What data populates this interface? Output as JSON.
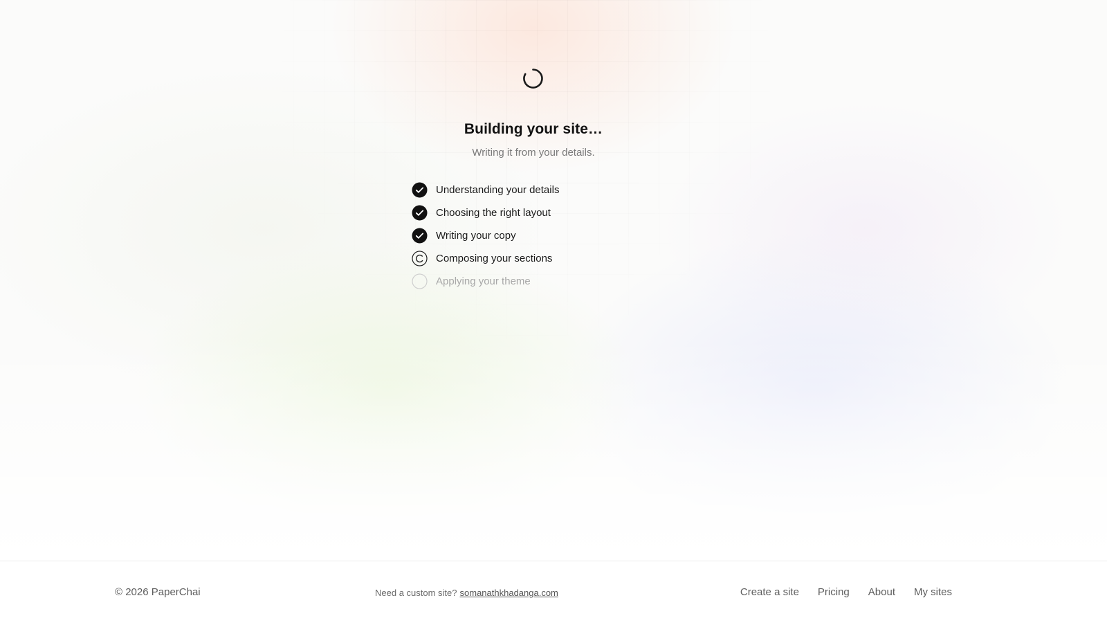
{
  "loader": {
    "title": "Building your site…",
    "subtitle": "Writing it from your details."
  },
  "steps": [
    {
      "label": "Understanding your details",
      "status": "done"
    },
    {
      "label": "Choosing the right layout",
      "status": "done"
    },
    {
      "label": "Writing your copy",
      "status": "done"
    },
    {
      "label": "Composing your sections",
      "status": "in-progress"
    },
    {
      "label": "Applying your theme",
      "status": "pending"
    }
  ],
  "footer": {
    "copyright": "© 2026 PaperChai",
    "custom_text": "Need a custom site?",
    "custom_link": "somanathkhadanga.com",
    "nav": [
      "Create a site",
      "Pricing",
      "About",
      "My sites"
    ]
  },
  "icons": {
    "spinner": "loading-spinner-icon",
    "done": "check-circle-icon",
    "in_progress": "progress-circle-icon",
    "pending": "empty-circle-icon"
  },
  "colors": {
    "text": "#111111",
    "muted": "#7a7a7a",
    "pending": "#a8a8a8",
    "check_fill": "#111111"
  }
}
